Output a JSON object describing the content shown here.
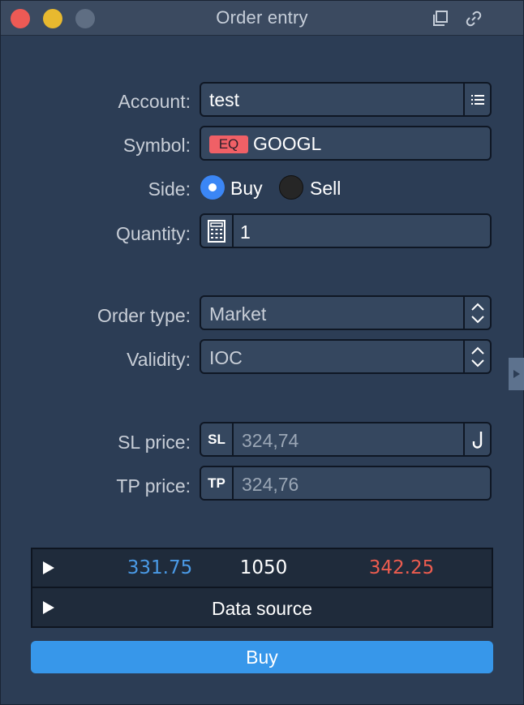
{
  "window": {
    "title": "Order entry"
  },
  "account": {
    "label": "Account:",
    "value": "test"
  },
  "symbol": {
    "label": "Symbol:",
    "badge": "EQ",
    "value": "GOOGL",
    "badge_color": "#f06066"
  },
  "side": {
    "label": "Side:",
    "options": [
      "Buy",
      "Sell"
    ],
    "selected": "Buy"
  },
  "quantity": {
    "label": "Quantity:",
    "value": "1"
  },
  "order_type": {
    "label": "Order type:",
    "value": "Market"
  },
  "validity": {
    "label": "Validity:",
    "value": "IOC"
  },
  "sl_price": {
    "label": "SL price:",
    "prefix": "SL",
    "placeholder": "324,74"
  },
  "tp_price": {
    "label": "TP price:",
    "prefix": "TP",
    "placeholder": "324,76"
  },
  "quote": {
    "bid": "331.75",
    "size": "1050",
    "ask": "342.25",
    "bid_color": "#4a9ae6",
    "ask_color": "#ec5c4f"
  },
  "data_source": {
    "label": "Data source"
  },
  "submit": {
    "label": "Buy",
    "color": "#3797ea"
  },
  "icons": {
    "close": "close-icon",
    "minimize": "minimize-icon",
    "maximize": "maximize-icon",
    "copy": "copy-window-icon",
    "link": "link-icon",
    "list": "list-icon",
    "calculator": "calculator-icon",
    "stepper": "stepper-icon",
    "hook": "hook-icon",
    "expand": "expand-right-icon",
    "play": "play-icon"
  }
}
